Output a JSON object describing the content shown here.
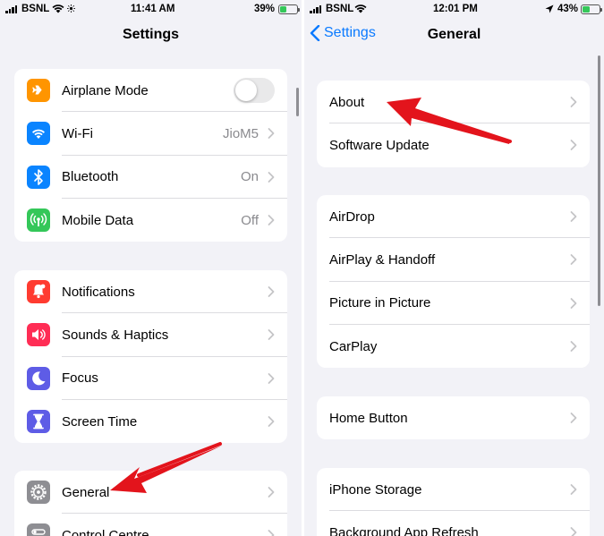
{
  "colors": {
    "accent": "#0a7aff",
    "airplane": "#ff9500",
    "wifi": "#0a84ff",
    "bluetooth": "#0a84ff",
    "mobile_data": "#34c759",
    "notifications": "#ff3b30",
    "sounds": "#ff2d55",
    "focus": "#5e5ce6",
    "screen_time": "#5e5ce6",
    "general": "#8e8e93",
    "control_centre": "#8e8e93",
    "arrow": "#e3141c"
  },
  "left": {
    "status": {
      "carrier": "BSNL",
      "time": "11:41 AM",
      "battery": "39%",
      "battery_level": 0.39
    },
    "title": "Settings",
    "group1": [
      {
        "label": "Airplane Mode",
        "icon": "airplane-icon",
        "toggle_on": false
      },
      {
        "label": "Wi-Fi",
        "icon": "wifi-icon",
        "value": "JioM5"
      },
      {
        "label": "Bluetooth",
        "icon": "bluetooth-icon",
        "value": "On"
      },
      {
        "label": "Mobile Data",
        "icon": "antenna-icon",
        "value": "Off"
      }
    ],
    "group2": [
      {
        "label": "Notifications",
        "icon": "bell-icon"
      },
      {
        "label": "Sounds & Haptics",
        "icon": "speaker-icon"
      },
      {
        "label": "Focus",
        "icon": "moon-icon"
      },
      {
        "label": "Screen Time",
        "icon": "hourglass-icon"
      }
    ],
    "group3": [
      {
        "label": "General",
        "icon": "gear-icon"
      },
      {
        "label": "Control Centre",
        "icon": "switches-icon"
      }
    ]
  },
  "right": {
    "status": {
      "carrier": "BSNL",
      "time": "12:01 PM",
      "battery": "43%",
      "battery_level": 0.43
    },
    "back_label": "Settings",
    "title": "General",
    "group1": [
      {
        "label": "About"
      },
      {
        "label": "Software Update"
      }
    ],
    "group2": [
      {
        "label": "AirDrop"
      },
      {
        "label": "AirPlay & Handoff"
      },
      {
        "label": "Picture in Picture"
      },
      {
        "label": "CarPlay"
      }
    ],
    "group3": [
      {
        "label": "Home Button"
      }
    ],
    "group4": [
      {
        "label": "iPhone Storage"
      },
      {
        "label": "Background App Refresh"
      }
    ]
  }
}
